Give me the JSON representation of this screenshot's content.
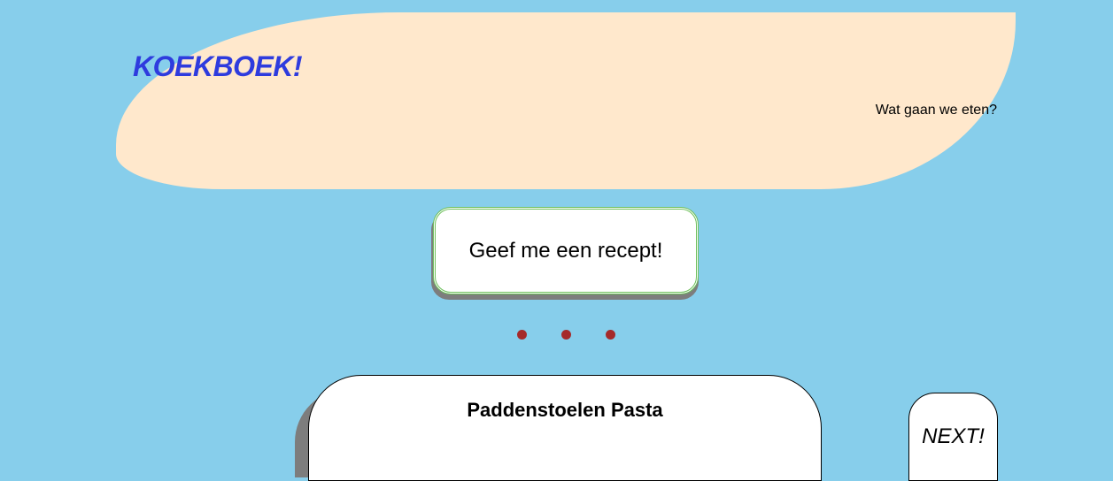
{
  "header": {
    "title": "KOEKBOEK!",
    "tagline": "Wat gaan we eten?"
  },
  "actions": {
    "recipe_button_label": "Geef me een recept!",
    "next_button_label": "NEXT!"
  },
  "loader": {
    "dot_count": 3
  },
  "recipe": {
    "title": "Paddenstoelen Pasta"
  },
  "colors": {
    "background": "#87CEEB",
    "header_background": "#FFE8CC",
    "title_color": "#2E3BDE",
    "button_border": "#6CBF5A",
    "loader_dot": "#A52A2A"
  }
}
